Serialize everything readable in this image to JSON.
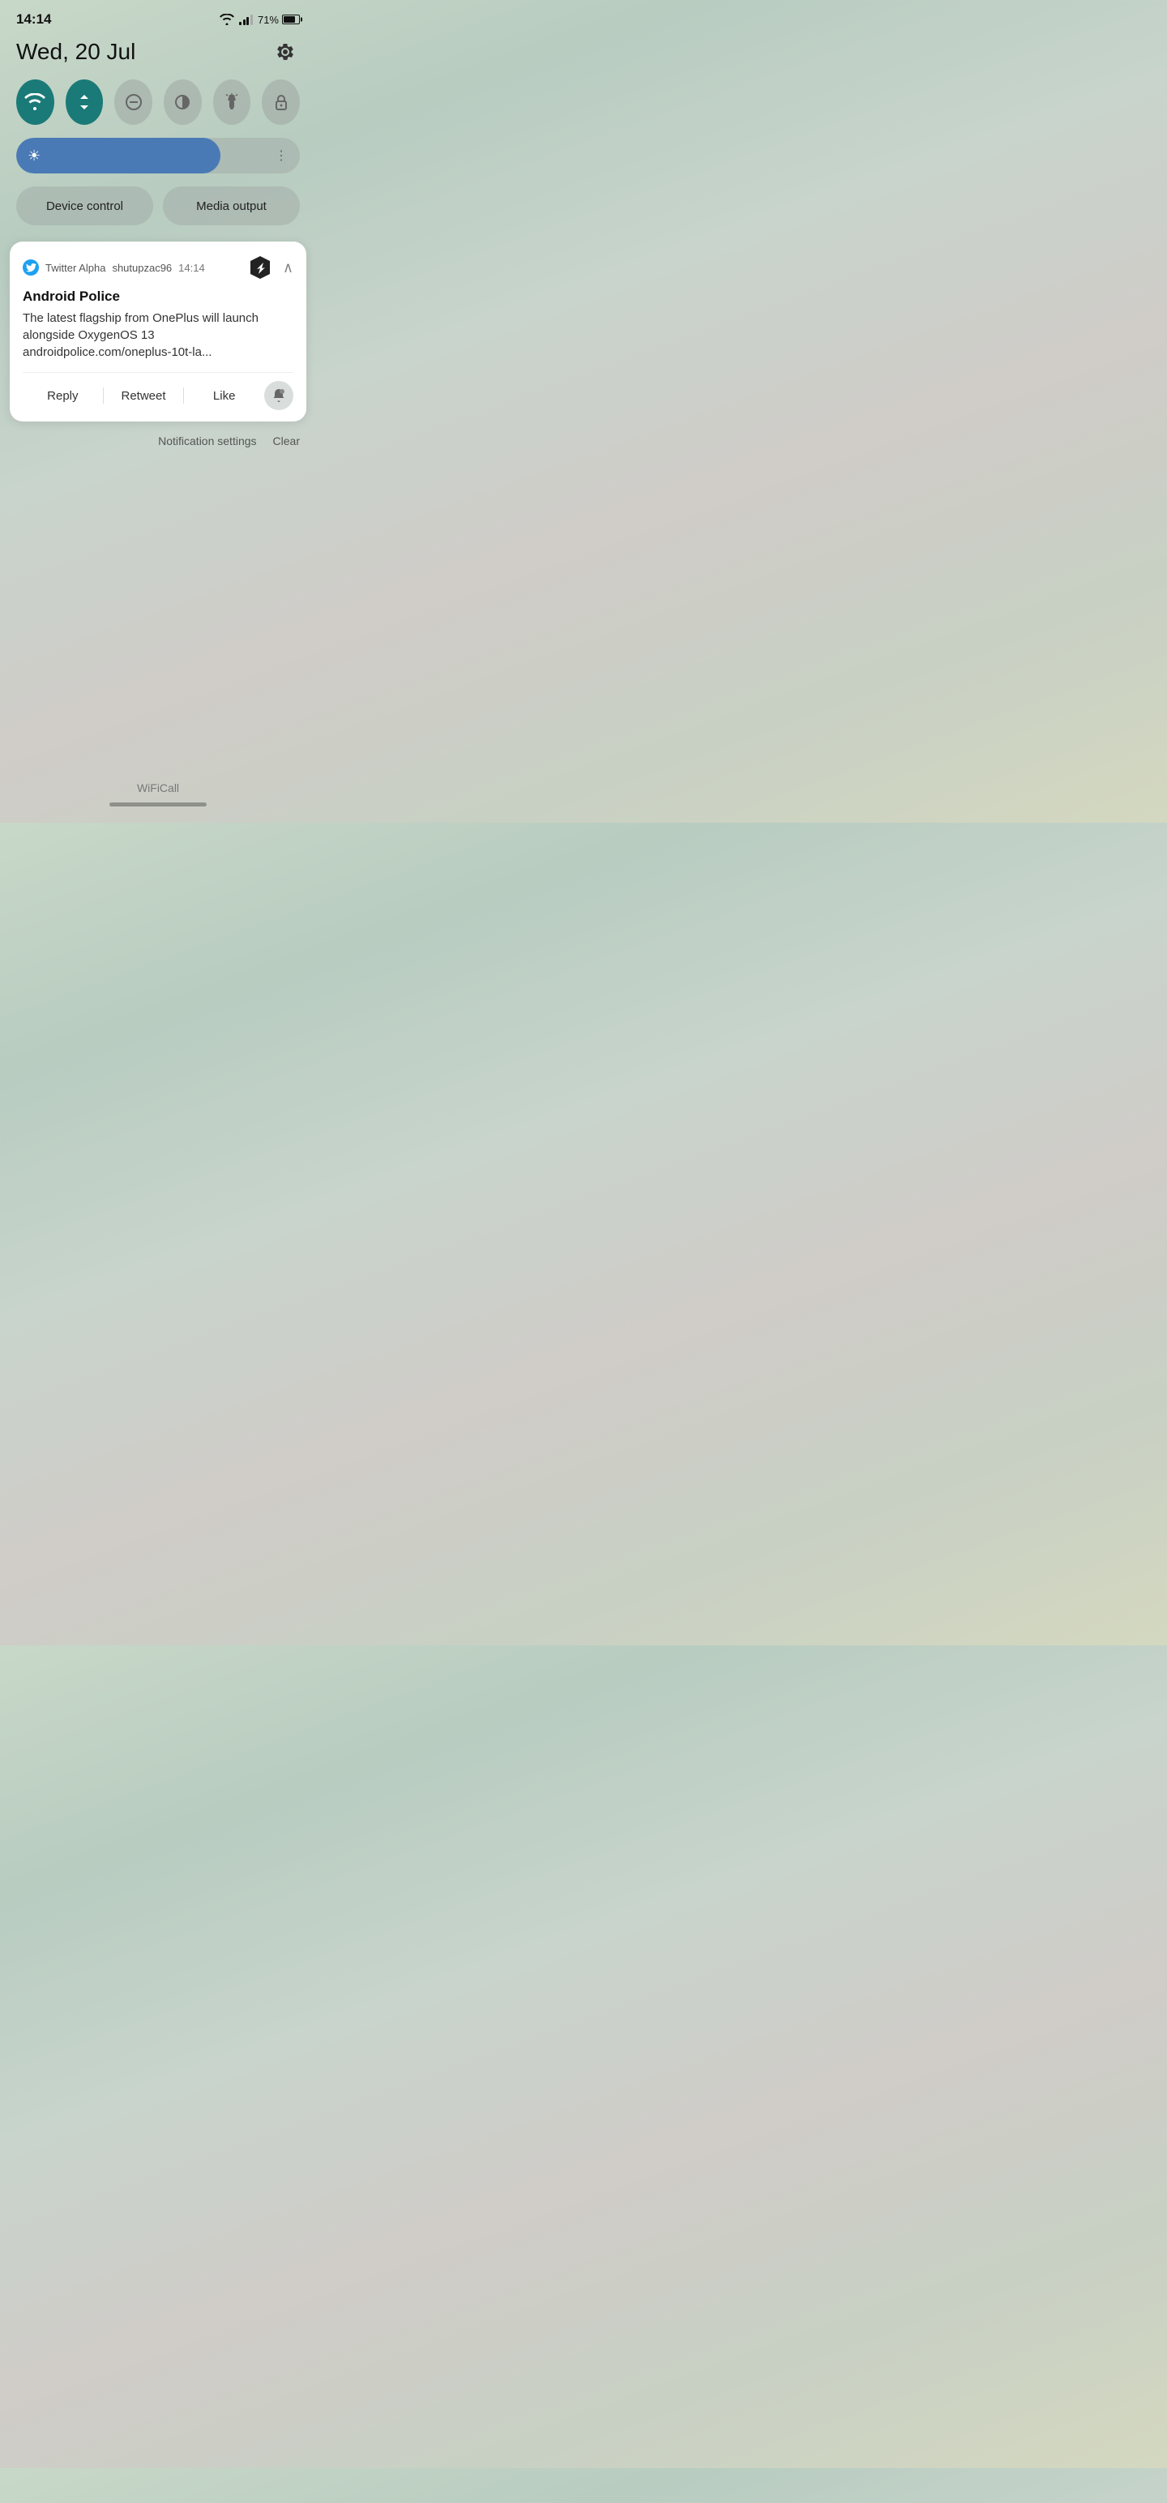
{
  "status_bar": {
    "time": "14:14",
    "battery_percent": "71%"
  },
  "date_row": {
    "date": "Wed, 20 Jul",
    "settings_icon": "gear-icon"
  },
  "quick_toggles": [
    {
      "id": "wifi",
      "icon": "📶",
      "active": true,
      "label": "WiFi"
    },
    {
      "id": "data",
      "icon": "⇅",
      "active": true,
      "label": "Data"
    },
    {
      "id": "dnd",
      "icon": "⊖",
      "active": false,
      "label": "DND"
    },
    {
      "id": "night",
      "icon": "☾",
      "active": false,
      "label": "Night"
    },
    {
      "id": "torch",
      "icon": "🔦",
      "active": false,
      "label": "Torch"
    },
    {
      "id": "screen_lock",
      "icon": "🔒",
      "active": false,
      "label": "Screen Lock"
    }
  ],
  "brightness": {
    "level": 72,
    "sun_icon": "sun-icon"
  },
  "action_buttons": {
    "device_control": "Device control",
    "media_output": "Media output"
  },
  "notification": {
    "app_name": "Twitter Alpha",
    "username": "shutupzac96",
    "time": "14:14",
    "title": "Android Police",
    "body": "The latest flagship from OnePlus will launch alongside OxygenOS 13 androidpolice.com/oneplus-10t-la...",
    "actions": {
      "reply": "Reply",
      "retweet": "Retweet",
      "like": "Like"
    }
  },
  "notification_settings": {
    "settings_label": "Notification settings",
    "clear_label": "Clear"
  },
  "bottom": {
    "wifi_call": "WiFiCall"
  }
}
